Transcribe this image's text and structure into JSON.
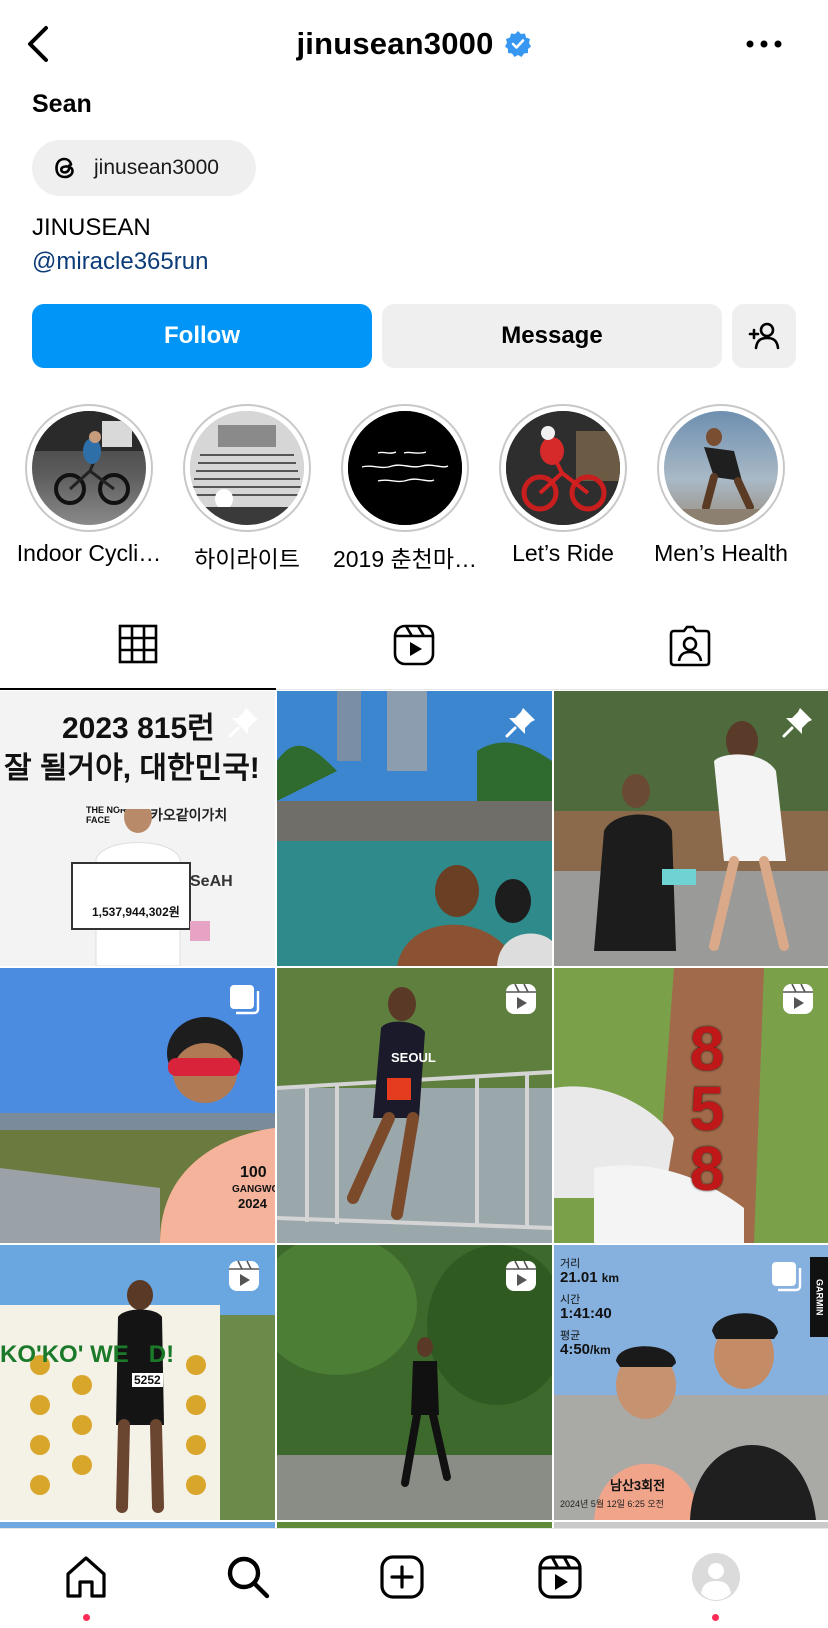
{
  "header": {
    "username": "jinusean3000",
    "verified_icon": "verified-badge-icon",
    "accent": "#3897f0"
  },
  "profile": {
    "name": "Sean",
    "threads_handle": "jinusean3000",
    "bio": "JINUSEAN",
    "link": "@miracle365run"
  },
  "actions": {
    "follow": "Follow",
    "message": "Message",
    "follow_color": "#0095f6"
  },
  "highlights": [
    {
      "label": "Indoor Cycli…"
    },
    {
      "label": "하이라이트"
    },
    {
      "label": "2019 춘천마…"
    },
    {
      "label": "Let’s Ride"
    },
    {
      "label": "Men’s Health"
    }
  ],
  "tabs": [
    "grid-tab",
    "reels-tab",
    "tagged-tab"
  ],
  "posts": [
    {
      "badge": "pin",
      "overlay": {
        "l1": "2023 815런",
        "l2": "잘 될거야, 대한민국!",
        "amount": "1,537,944,302원",
        "brands": "THE NORTH FACE",
        "brand2": "카오같이가치",
        "brand3": "SeAH"
      }
    },
    {
      "badge": "pin"
    },
    {
      "badge": "pin"
    },
    {
      "badge": "carousel",
      "overlay": {
        "shirt": "100",
        "shirt2": "GANGWON",
        "shirt3": "2024"
      }
    },
    {
      "badge": "reel",
      "overlay": {
        "bib": "SEOUL"
      }
    },
    {
      "badge": "reel",
      "overlay": {
        "number": "858"
      }
    },
    {
      "badge": "reel",
      "overlay": {
        "banner": "KO'KO' WE   D!",
        "bib": "5252"
      }
    },
    {
      "badge": "reel"
    },
    {
      "badge": "carousel",
      "overlay": {
        "dist_label": "거리",
        "dist": "21.01",
        "dist_unit": "km",
        "time_label": "시간",
        "time": "1:41:40",
        "pace_label": "평균",
        "pace": "4:50",
        "pace_unit": "/km",
        "caption": "남산3회전",
        "date": "2024년 5월 12일 6:25 오전",
        "brand": "GARMIN"
      }
    }
  ]
}
